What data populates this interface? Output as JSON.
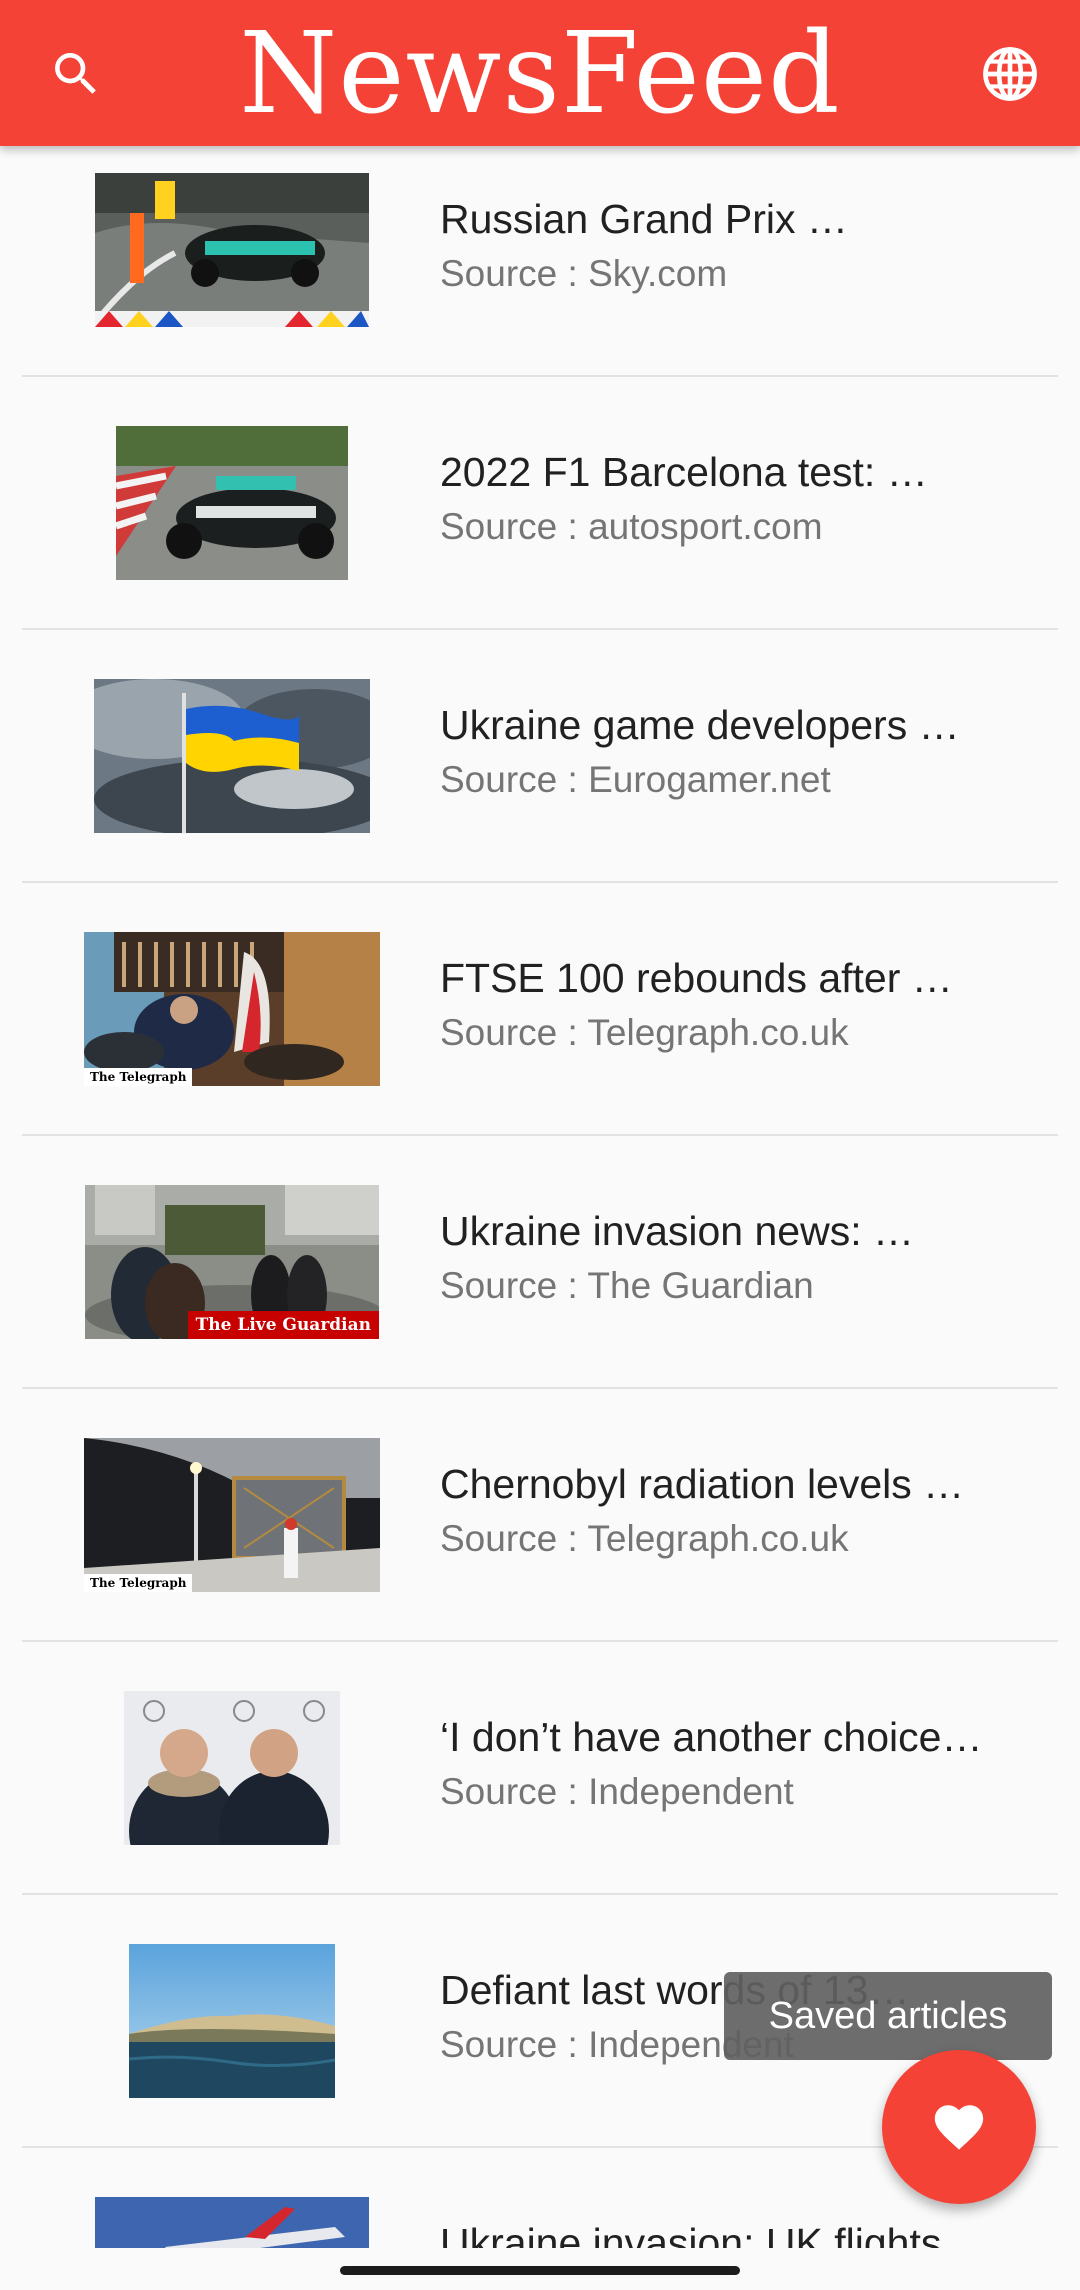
{
  "app": {
    "title": "NewsFeed",
    "accent_color": "#f44336",
    "icons": {
      "left": "search-icon",
      "right": "globe-icon",
      "fab": "heart-icon"
    }
  },
  "articles": [
    {
      "title": "Russian Grand Prix …",
      "source": "Source : Sky.com"
    },
    {
      "title": "2022 F1 Barcelona test: …",
      "source": "Source : autosport.com"
    },
    {
      "title": "Ukraine game developers …",
      "source": "Source : Eurogamer.net"
    },
    {
      "title": "FTSE 100 rebounds after …",
      "source": "Source : Telegraph.co.uk",
      "watermark": "The Telegraph"
    },
    {
      "title": "Ukraine invasion news: …",
      "source": "Source : The Guardian",
      "watermark": "The Live Guardian"
    },
    {
      "title": "Chernobyl radiation levels …",
      "source": "Source : Telegraph.co.uk",
      "watermark": "The Telegraph"
    },
    {
      "title": "‘I don’t have another choice…",
      "source": "Source : Independent"
    },
    {
      "title": "Defiant last words of 13…",
      "source": "Source : Independent"
    },
    {
      "title": "Ukraine invasion: UK flights …",
      "source": ""
    }
  ],
  "saved_tooltip": "Saved articles"
}
